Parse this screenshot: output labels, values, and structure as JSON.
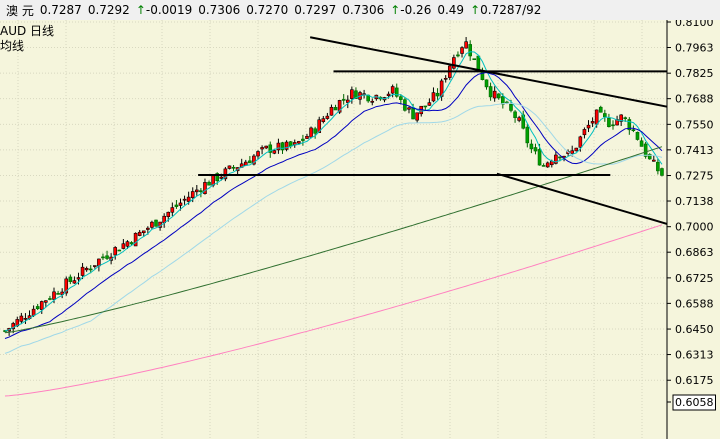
{
  "header": {
    "name": "澳 元",
    "open": "0.7287",
    "high": "0.7292",
    "change": "-0.0019",
    "v1": "0.7306",
    "v2": "0.7270",
    "v3": "0.7297",
    "v4": "0.7306",
    "pct": "-0.26",
    "v5": "0.49",
    "v6": "0.7287/92"
  },
  "labels": {
    "line1": "AUD  日线",
    "line2": "均线"
  },
  "chart_data": {
    "type": "candlestick",
    "yaxis_ticks": [
      "0.8100",
      "0.7963",
      "0.7825",
      "0.7688",
      "0.7550",
      "0.7413",
      "0.7275",
      "0.7138",
      "0.7000",
      "0.6863",
      "0.6725",
      "0.6588",
      "0.6450",
      "0.6313",
      "0.6175",
      "0.6058"
    ],
    "ylim": [
      0.6058,
      0.81
    ],
    "current_price": "0.6058",
    "colors": {
      "up": "#000000",
      "down": "#006400",
      "ma5": "#00c0c0",
      "ma10": "#0000c0",
      "ma20": "#a0d8e8",
      "ma60": "#2f6f2f",
      "ma120": "#ff80c0"
    },
    "trend_lines": [
      {
        "name": "upper-channel",
        "from": [
          0.465,
          0.8018
        ],
        "to": [
          1.0,
          0.7645
        ]
      },
      {
        "name": "lower-channel",
        "from": [
          0.745,
          0.7285
        ],
        "to": [
          1.0,
          0.7015
        ]
      },
      {
        "name": "resistance",
        "from": [
          0.5,
          0.7835
        ],
        "to": [
          1.0,
          0.7835
        ]
      },
      {
        "name": "support",
        "from": [
          0.297,
          0.7278
        ],
        "to": [
          0.915,
          0.7278
        ]
      }
    ]
  }
}
